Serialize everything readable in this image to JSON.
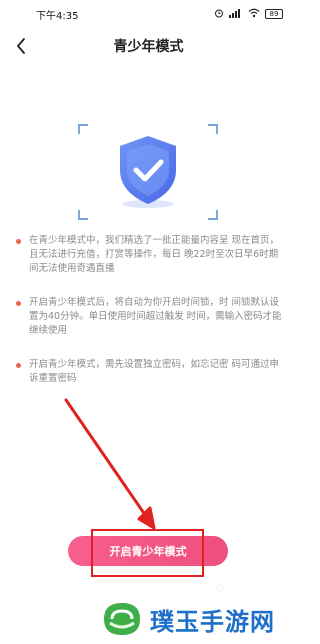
{
  "status_bar": {
    "time": "下午4:35",
    "battery": "89",
    "icons": [
      "alarm-icon",
      "signal-icon",
      "wifi-icon",
      "battery-icon"
    ]
  },
  "nav": {
    "back_icon": "chevron-left-icon",
    "title": "青少年模式"
  },
  "hero": {
    "icon": "shield-check-icon",
    "colors": {
      "shield": "#5b7ef0",
      "frame": "#7ea4d8"
    }
  },
  "notes": [
    {
      "text": "在青少年模式中，我们精选了一批正能量内容呈 现在首页，且无法进行充值，打赏等操作，每日 晚22时至次日早6时期间无法使用奇遇直播"
    },
    {
      "text": "开启青少年模式后，将自动为你开启时间锁，时 间锁默认设置为40分钟。单日使用时间超过触发 时间，需输入密码才能继续使用"
    },
    {
      "text": "开启青少年模式，需先设置独立密码，如忘记密 码可通过申诉重置密码"
    }
  ],
  "action": {
    "button_label": "开启青少年模式",
    "colors": {
      "button": "#f2577f",
      "highlight": "#e0211f",
      "arrow": "#e0211f"
    }
  },
  "watermark": {
    "text": "璞玉手游网"
  }
}
